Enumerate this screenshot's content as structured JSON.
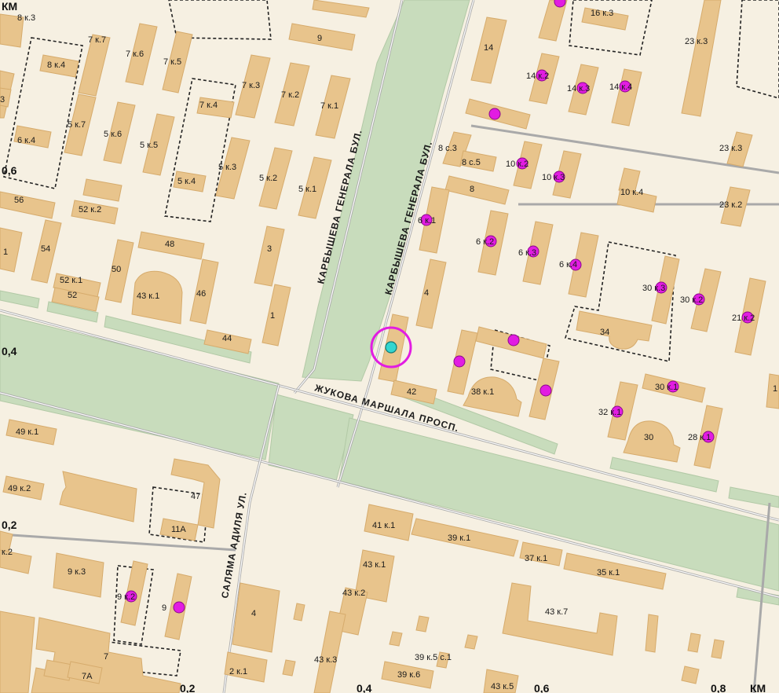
{
  "streets": {
    "karbysheva_left": "КАРБЫШЕВА ГЕНЕРАЛА БУЛ.",
    "karbysheva_right": "КАРБЫШЕВА ГЕНЕРАЛА БУЛ.",
    "zhukova": "ЖУКОВА МАРШАЛА ПРОСП.",
    "salyama": "САЛЯМА АДИЛЯ УЛ."
  },
  "scale": {
    "km_top": "КМ",
    "km_bottom": "КМ",
    "v_06": "0,6",
    "v_04_left": "0,4",
    "v_02_left": "0,2",
    "v_02_bottom": "0,2",
    "v_04_bottom": "0,4",
    "v_06_bottom": "0,6",
    "v_08_bottom": "0,8",
    "v_3": "3"
  },
  "colors": {
    "building": "#e8c48c",
    "green": "#c8dcbc",
    "background": "#f6f0e2",
    "poi": "#e21ce2",
    "selected_marker": "#33d6d0",
    "selected_ring": "#e21ce2"
  },
  "selected_marker": {
    "label": ""
  },
  "labels": {
    "l0": "8 к.3",
    "l1": "9",
    "l2": "7 к.7",
    "l3": "7 к.6",
    "l4": "7 к.5",
    "l5": "8 к.4",
    "l6": "7 к.3",
    "l7": "7 к.2",
    "l8": "7 к.1",
    "l9": "7 к.4",
    "l10": "5 к.7",
    "l11": "5 к.6",
    "l12": "5 к.5",
    "l13": "5 к.3",
    "l14": "5 к.2",
    "l15": "5 к.1",
    "l16": "5 к.4",
    "l17": "6 к.4",
    "l18": "56",
    "l19": "52 к.2",
    "l20": "54",
    "l21": "48",
    "l22": "50",
    "l23": "52 к.1",
    "l24": "52",
    "l25": "43 к.1",
    "l26": "46",
    "l27": "3",
    "l28": "1",
    "l29": "44",
    "l30": "14",
    "l31": "16 к.3",
    "l32": "23 к.3",
    "l33": "14 к.2",
    "l34": "14 к.3",
    "l35": "14 к.4",
    "l36": "8 с.3",
    "l37": "8 с.5",
    "l38": "10 к.2",
    "l39": "10 к.3",
    "l40": "23 к.3",
    "l41": "8",
    "l42": "10 к.4",
    "l43": "23 к.2",
    "l44": "6 к.1",
    "l45": "6 к.2",
    "l46": "6 к.3",
    "l47": "6 к.4",
    "l48": "4",
    "l49": "30 к.3",
    "l50": "30 к.2",
    "l51": "21 к.2",
    "l52": "34",
    "l53": "42",
    "l54": "38 к.1",
    "l55": "30 к.1",
    "l56": "32 к.1",
    "l57": "30",
    "l58": "28 к.1",
    "l59": "49 к.1",
    "l60": "49 к.2",
    "l61": "47",
    "l62": "11А",
    "l63": "41 к.1",
    "l64": "39 к.1",
    "l65": "37 к.1",
    "l66": "43 к.1",
    "l67": "35 к.1",
    "l68": "43 к.2",
    "l69": "43 к.7",
    "l70": "9 к.3",
    "l71": "9 к.2",
    "l72": "9",
    "l73": "4",
    "l74": "43 к.3",
    "l75": "39 к.5 с.1",
    "l76": "2 к.1",
    "l77": "39 к.6",
    "l78": "43 к.5",
    "l79": "7",
    "l80": "7А",
    "l81": "к.2",
    "l82": "1",
    "l83": "1"
  }
}
